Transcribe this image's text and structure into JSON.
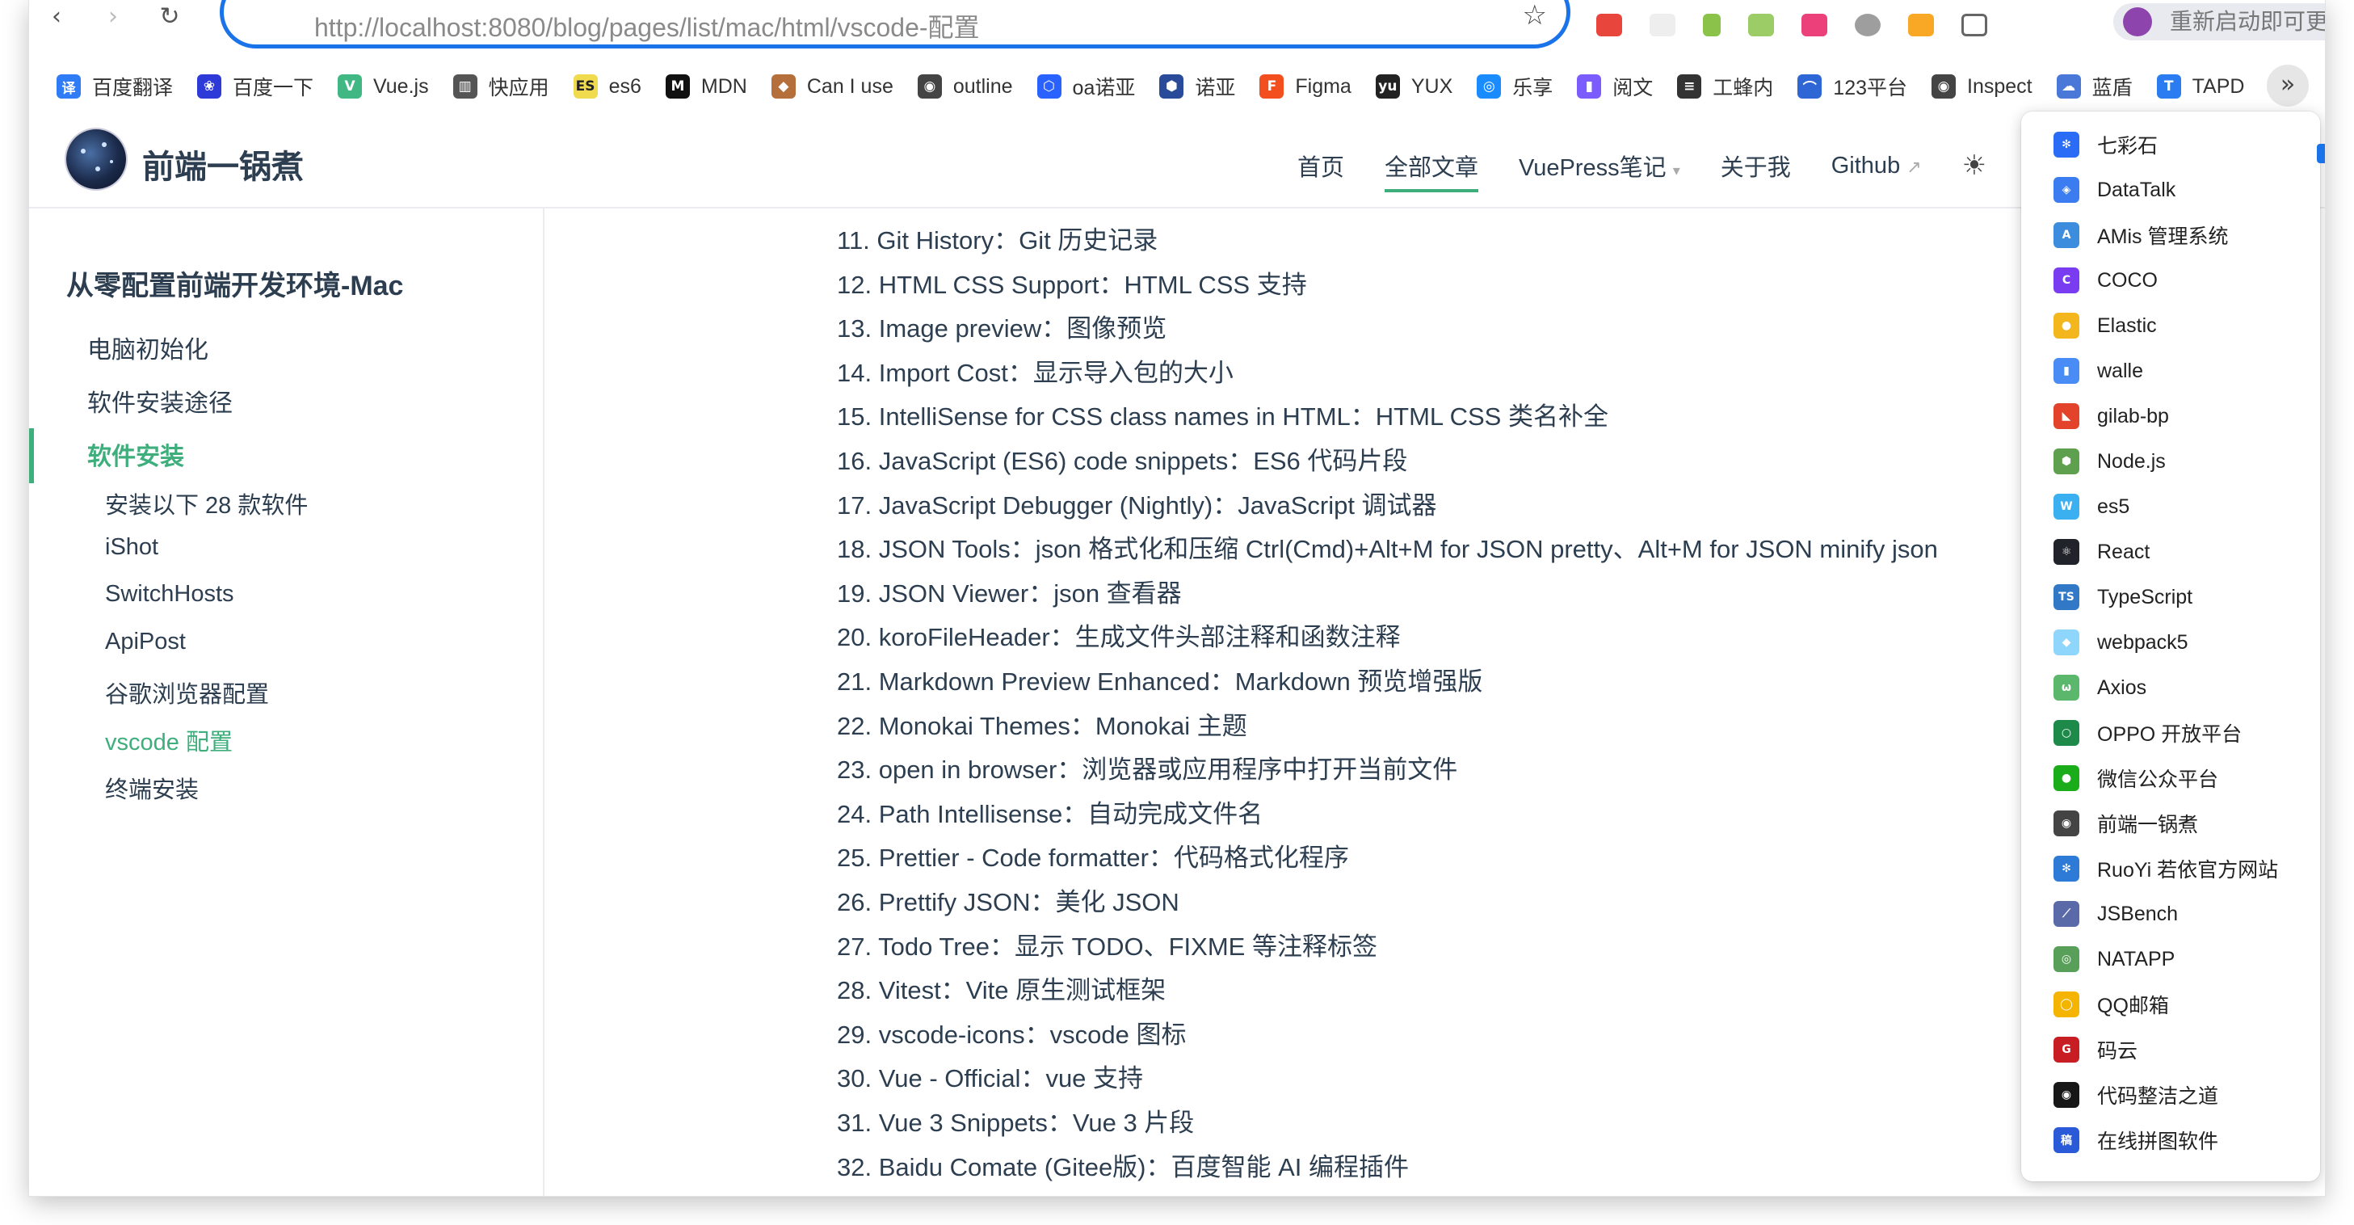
{
  "browser": {
    "nav": {
      "back_glyph": "‹",
      "forward_glyph": "›",
      "reload_glyph": "↻"
    },
    "omnibox": {
      "url": "http://localhost:8080/blog/pages/list/mac/html/vscode-配置",
      "star_icon": "star-icon"
    },
    "profile": {
      "label": "重新启动即可更新"
    },
    "more_bookmarks_glyph": "»"
  },
  "bookmarks": [
    {
      "label": "百度翻译",
      "icon_text": "译",
      "color": "#2f7cf6"
    },
    {
      "label": "百度一下",
      "icon_text": "❀",
      "color": "#2d3ad7"
    },
    {
      "label": "Vue.js",
      "icon_text": "V",
      "color": "#41b883"
    },
    {
      "label": "快应用",
      "icon_text": "▥",
      "color": "#555555"
    },
    {
      "label": "es6",
      "icon_text": "ES",
      "color": "#f0db4f"
    },
    {
      "label": "MDN",
      "icon_text": "M",
      "color": "#111111"
    },
    {
      "label": "Can I use",
      "icon_text": "◆",
      "color": "#b56f3a"
    },
    {
      "label": "outline",
      "icon_text": "◉",
      "color": "#444444"
    },
    {
      "label": "oa诺亚",
      "icon_text": "⬡",
      "color": "#2962ff"
    },
    {
      "label": "诺亚",
      "icon_text": "⬢",
      "color": "#2a4a9a"
    },
    {
      "label": "Figma",
      "icon_text": "F",
      "color": "#f24e1e"
    },
    {
      "label": "YUX",
      "icon_text": "yu",
      "color": "#222222"
    },
    {
      "label": "乐享",
      "icon_text": "◎",
      "color": "#1a8cff"
    },
    {
      "label": "阅文",
      "icon_text": "▮",
      "color": "#7b5cff"
    },
    {
      "label": "工蜂内",
      "icon_text": "≡",
      "color": "#333333"
    },
    {
      "label": "123平台",
      "icon_text": "⌒",
      "color": "#2f66d6"
    },
    {
      "label": "Inspect",
      "icon_text": "◉",
      "color": "#444444"
    },
    {
      "label": "蓝盾",
      "icon_text": "☁",
      "color": "#4a78d8"
    },
    {
      "label": "TAPD",
      "icon_text": "T",
      "color": "#2a7cf0"
    }
  ],
  "site": {
    "title": "前端一锅煮",
    "nav": [
      {
        "label": "首页",
        "active": false
      },
      {
        "label": "全部文章",
        "active": true
      },
      {
        "label": "VuePress笔记",
        "active": false,
        "dropdown": true
      },
      {
        "label": "关于我",
        "active": false
      },
      {
        "label": "Github",
        "active": false,
        "external": true
      }
    ],
    "theme_toggle_glyph": "☀",
    "caret_glyph": "▾",
    "external_glyph": "↗"
  },
  "sidebar": {
    "group_title": "从零配置前端开发环境-Mac",
    "items": [
      {
        "label": "电脑初始化",
        "active": false
      },
      {
        "label": "软件安装途径",
        "active": false
      },
      {
        "label": "软件安装",
        "active": true
      }
    ],
    "subitems": [
      {
        "label": "安装以下 28 款软件",
        "active": false
      },
      {
        "label": "iShot",
        "active": false
      },
      {
        "label": "SwitchHosts",
        "active": false
      },
      {
        "label": "ApiPost",
        "active": false
      },
      {
        "label": "谷歌浏览器配置",
        "active": false
      },
      {
        "label": "vscode 配置",
        "active": true
      },
      {
        "label": "终端安装",
        "active": false
      }
    ]
  },
  "content": {
    "lines": [
      "11. Git History：Git 历史记录",
      "12. HTML CSS Support：HTML CSS 支持",
      "13. Image preview：图像预览",
      "14. Import Cost：显示导入包的大小",
      "15. IntelliSense for CSS class names in HTML：HTML CSS 类名补全",
      "16. JavaScript (ES6) code snippets：ES6 代码片段",
      "17. JavaScript Debugger (Nightly)：JavaScript 调试器",
      "18. JSON Tools：json 格式化和压缩 Ctrl(Cmd)+Alt+M for JSON pretty、Alt+M for JSON minify json",
      "19. JSON Viewer：json 查看器",
      "20. koroFileHeader：生成文件头部注释和函数注释",
      "21. Markdown Preview Enhanced：Markdown 预览增强版",
      "22. Monokai Themes：Monokai 主题",
      "23. open in browser：浏览器或应用程序中打开当前文件",
      "24. Path Intellisense：自动完成文件名",
      "25. Prettier - Code formatter：代码格式化程序",
      "26. Prettify JSON：美化 JSON",
      "27. Todo Tree：显示 TODO、FIXME 等注释标签",
      "28. Vitest：Vite 原生测试框架",
      "29. vscode-icons：vscode 图标",
      "30. Vue - Official：vue 支持",
      "31. Vue 3 Snippets：Vue 3 片段",
      "32. Baidu Comate (Gitee版)：百度智能 AI 编程插件"
    ]
  },
  "overflow_menu": {
    "items": [
      {
        "label": "七彩石",
        "icon_text": "✻",
        "color": "#2a6cf5"
      },
      {
        "label": "DataTalk",
        "icon_text": "◈",
        "color": "#3b7df0"
      },
      {
        "label": "AMis 管理系统",
        "icon_text": "A",
        "color": "#3c8dde"
      },
      {
        "label": "COCO",
        "icon_text": "C",
        "color": "#7a3cf0"
      },
      {
        "label": "Elastic",
        "icon_text": "●",
        "color": "#f3b61c"
      },
      {
        "label": "walle",
        "icon_text": "▮",
        "color": "#4a8cf5"
      },
      {
        "label": "gilab-bp",
        "icon_text": "◣",
        "color": "#e2432a"
      },
      {
        "label": "Node.js",
        "icon_text": "⬢",
        "color": "#5fa04e"
      },
      {
        "label": "es5",
        "icon_text": "W",
        "color": "#3bb0f0"
      },
      {
        "label": "React",
        "icon_text": "⚛",
        "color": "#20232a"
      },
      {
        "label": "TypeScript",
        "icon_text": "TS",
        "color": "#3178c6"
      },
      {
        "label": "webpack5",
        "icon_text": "◆",
        "color": "#8ed6fb"
      },
      {
        "label": "Axios",
        "icon_text": "ω",
        "color": "#5ab76b"
      },
      {
        "label": "OPPO 开放平台",
        "icon_text": "○",
        "color": "#1e8a4a"
      },
      {
        "label": "微信公众平台",
        "icon_text": "●",
        "color": "#1aad19"
      },
      {
        "label": "前端一锅煮",
        "icon_text": "◉",
        "color": "#444444"
      },
      {
        "label": "RuoYi 若依官方网站",
        "icon_text": "✻",
        "color": "#2d7bd6"
      },
      {
        "label": "JSBench",
        "icon_text": "⟋",
        "color": "#5a6aa8"
      },
      {
        "label": "NATAPP",
        "icon_text": "◎",
        "color": "#58a05a"
      },
      {
        "label": "QQ邮箱",
        "icon_text": "◯",
        "color": "#f4b400"
      },
      {
        "label": "码云",
        "icon_text": "G",
        "color": "#c71d23"
      },
      {
        "label": "代码整洁之道",
        "icon_text": "◉",
        "color": "#181717"
      },
      {
        "label": "在线拼图软件",
        "icon_text": "稿",
        "color": "#2a5ad8"
      }
    ]
  }
}
